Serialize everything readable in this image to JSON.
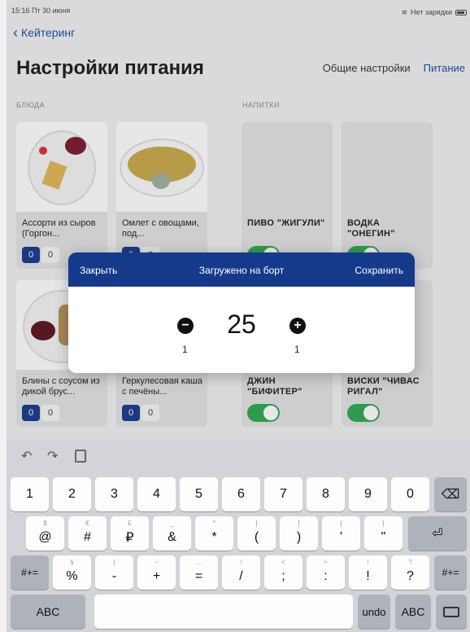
{
  "status_bar": {
    "time": "15:16",
    "date": "Пт 30 июня",
    "battery_text": "Нет зарядки"
  },
  "nav": {
    "back_label": "Кейтеринг",
    "title": "Настройки питания",
    "tabs": [
      "Общие настройки",
      "Питание"
    ]
  },
  "sections": {
    "dishes_label": "БЛЮДА",
    "drinks_label": "НАПИТКИ"
  },
  "dishes": [
    {
      "name": "Ассорти из сыров (Горгон...",
      "count_on": "0",
      "count_off": "0"
    },
    {
      "name": "Омлет с овощами, под...",
      "count_on": "0",
      "count_off": "0"
    },
    {
      "name": "Блины с соусом из дикой брус...",
      "count_on": "0",
      "count_off": "0"
    },
    {
      "name": "Геркулесовая каша с печёны...",
      "count_on": "0",
      "count_off": "0"
    }
  ],
  "drinks": [
    {
      "name": "ПИВО \"ЖИГУЛИ\"",
      "enabled": true
    },
    {
      "name": "ВОДКА \"ОНЕГИН\"",
      "enabled": true
    },
    {
      "name": "ДЖИН \"БИФИТЕР\"",
      "enabled": true
    },
    {
      "name": "ВИСКИ \"ЧИВАС РИГАЛ\"",
      "enabled": true
    }
  ],
  "modal": {
    "close_label": "Закрыть",
    "title": "Загружено на борт",
    "save_label": "Сохранить",
    "value": "25",
    "minus_step": "1",
    "plus_step": "1"
  },
  "keyboard": {
    "toolbar": {
      "undo_icon": "↶",
      "redo_icon": "↷",
      "paste_icon": "paste-icon"
    },
    "row1": [
      "1",
      "2",
      "3",
      "4",
      "5",
      "6",
      "7",
      "8",
      "9",
      "0"
    ],
    "row2": [
      {
        "sub": "$",
        "main": "@"
      },
      {
        "sub": "€",
        "main": "#"
      },
      {
        "sub": "£",
        "main": "₽"
      },
      {
        "sub": "_",
        "main": "&"
      },
      {
        "sub": "^",
        "main": "*"
      },
      {
        "sub": "[",
        "main": "("
      },
      {
        "sub": "]",
        "main": ")"
      },
      {
        "sub": "{",
        "main": "'"
      },
      {
        "sub": "}",
        "main": "\""
      }
    ],
    "row3": [
      {
        "sub": "§",
        "main": "%"
      },
      {
        "sub": "|",
        "main": "-"
      },
      {
        "sub": "~",
        "main": "+"
      },
      {
        "sub": "…",
        "main": "="
      },
      {
        "sub": "\\",
        "main": "/"
      },
      {
        "sub": "<",
        "main": ";"
      },
      {
        "sub": ">",
        "main": ":"
      },
      {
        "sub": "!",
        "main": "!"
      },
      {
        "sub": "?",
        "main": "?"
      }
    ],
    "symbols_label": "#+=",
    "abc_label": "ABC",
    "undo_label": "undo",
    "backspace_icon": "⌫",
    "return_icon": "⏎",
    "hide_keyboard_icon": "keyboard-icon"
  }
}
